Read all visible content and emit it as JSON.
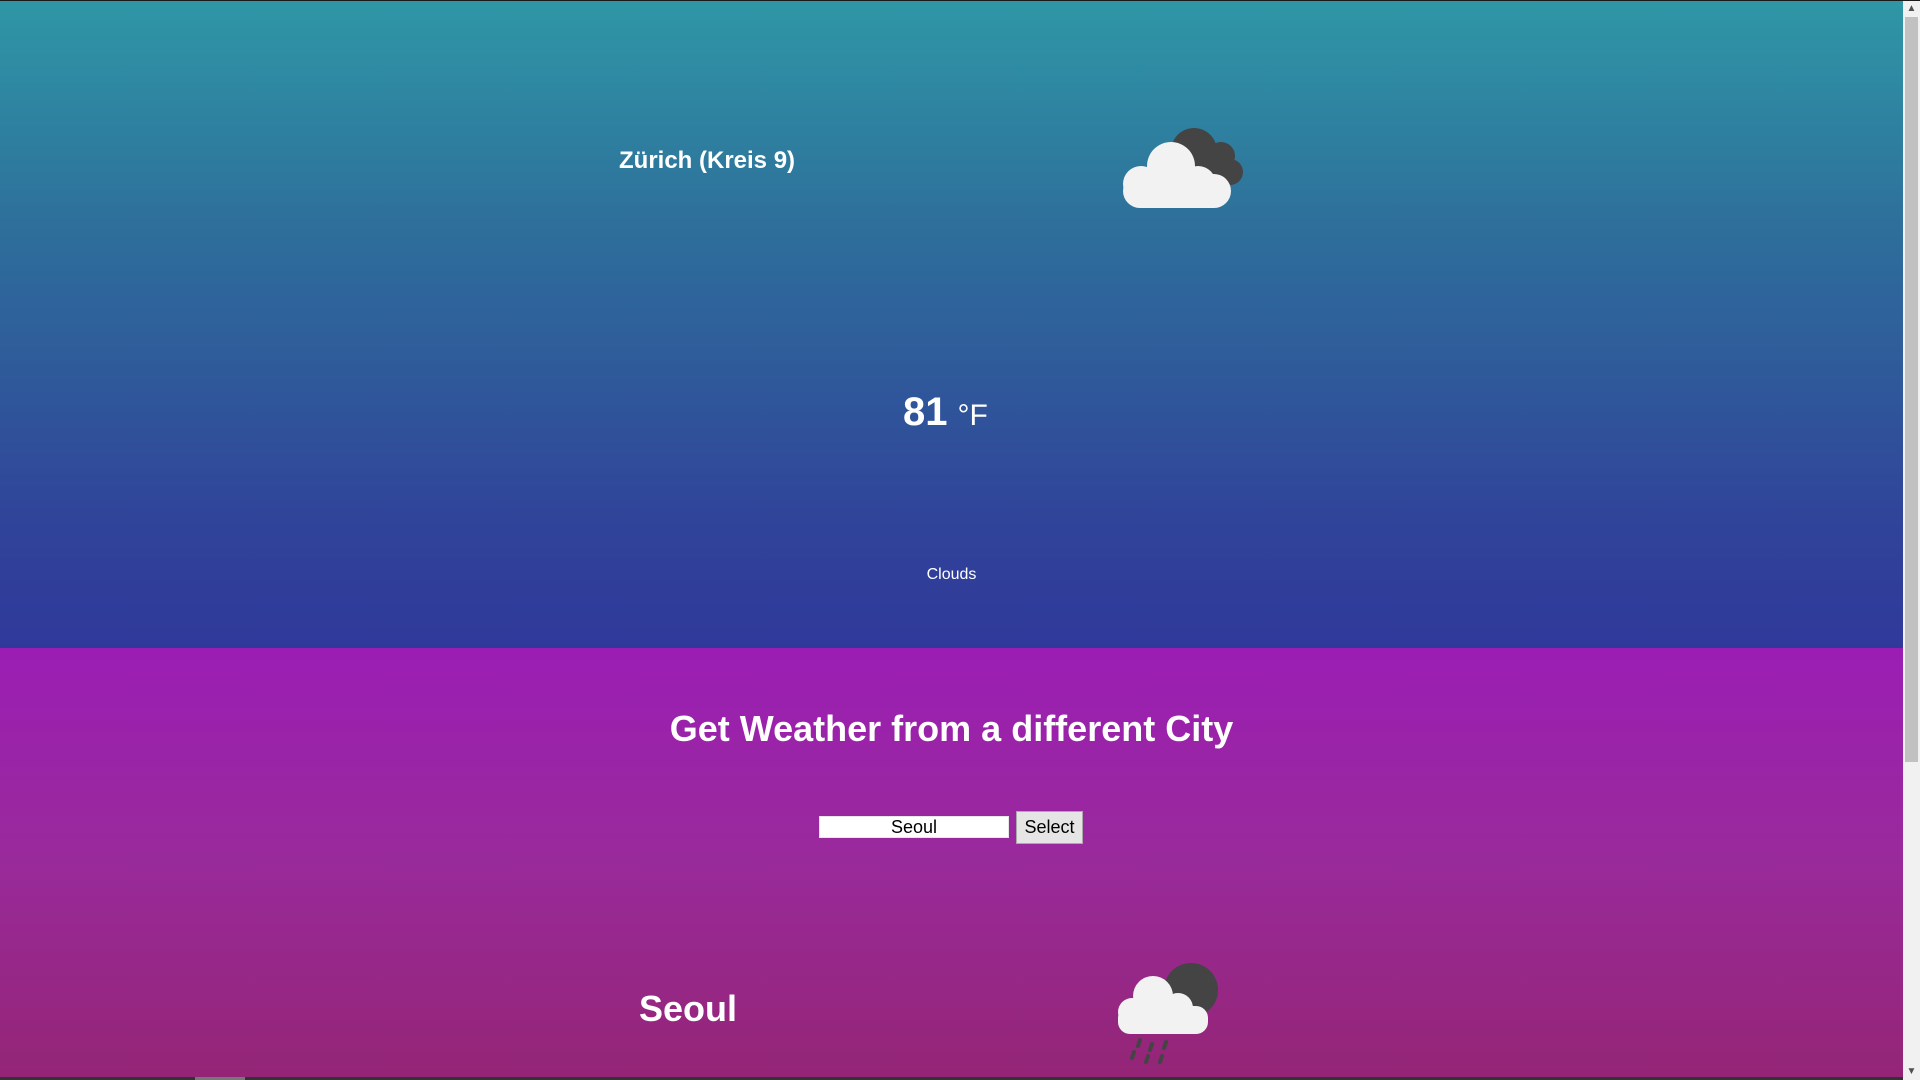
{
  "current": {
    "city": "Zürich (Kreis 9)",
    "temperature": "81",
    "unit": "°F",
    "condition": "Clouds",
    "icon": "partly-cloudy-icon"
  },
  "search": {
    "heading": "Get Weather from a different City",
    "input_value": "Seoul",
    "button_label": "Select"
  },
  "result": {
    "city": "Seoul",
    "icon": "rain-cloud-icon"
  },
  "scrollbar": {
    "up_arrow": "▲",
    "down_arrow": "▼"
  },
  "colors": {
    "top_gradient_start": "#2f97a6",
    "top_gradient_end": "#30399a",
    "bottom_gradient_start": "#9b1eb4",
    "bottom_gradient_end": "#942575",
    "cloud_light": "#f2f2f2",
    "cloud_dark": "#444444"
  }
}
